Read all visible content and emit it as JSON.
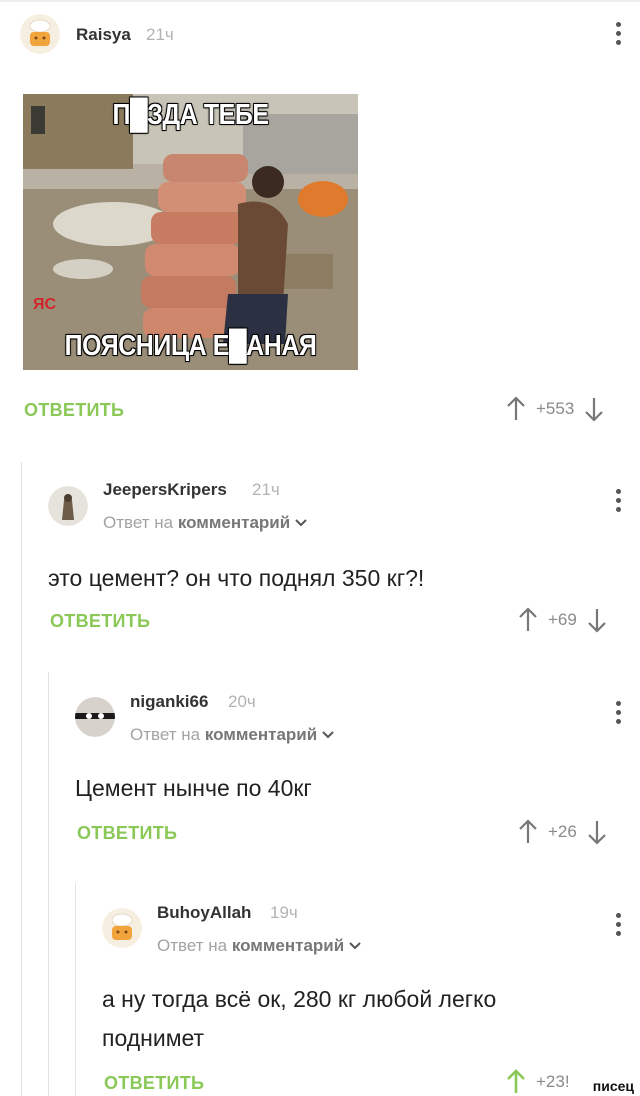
{
  "post": {
    "author": "Raisya",
    "time": "21ч",
    "image_caption_top": "П█ЗДА ТЕБЕ",
    "image_caption_bottom": "ПОЯСНИЦА Е█АНАЯ",
    "image_logo": "ЯС",
    "reply_label": "ОТВЕТИТЬ",
    "rating": "+553"
  },
  "comments": [
    {
      "author": "JeepersKripers",
      "time": "21ч",
      "reply_to_prefix": "Ответ на",
      "reply_to_target": "комментарий",
      "text": "это цемент? он что поднял 350 кг?!",
      "reply_label": "ОТВЕТИТЬ",
      "rating": "+69"
    },
    {
      "author": "niganki66",
      "time": "20ч",
      "reply_to_prefix": "Ответ на",
      "reply_to_target": "комментарий",
      "text": "Цемент нынче по 40кг",
      "reply_label": "ОТВЕТИТЬ",
      "rating": "+26"
    },
    {
      "author": "BuhoyAllah",
      "time": "19ч",
      "reply_to_prefix": "Ответ на",
      "reply_to_target": "комментарий",
      "text_line1": "а ну тогда всё ок, 280 кг любой легко",
      "text_line2": "поднимет",
      "reply_label": "ОТВЕТИТЬ",
      "rating": "+23!"
    }
  ],
  "watermark": "писец",
  "colors": {
    "accent": "#8ac858",
    "muted": "#a3a3a3",
    "text": "#222222"
  }
}
